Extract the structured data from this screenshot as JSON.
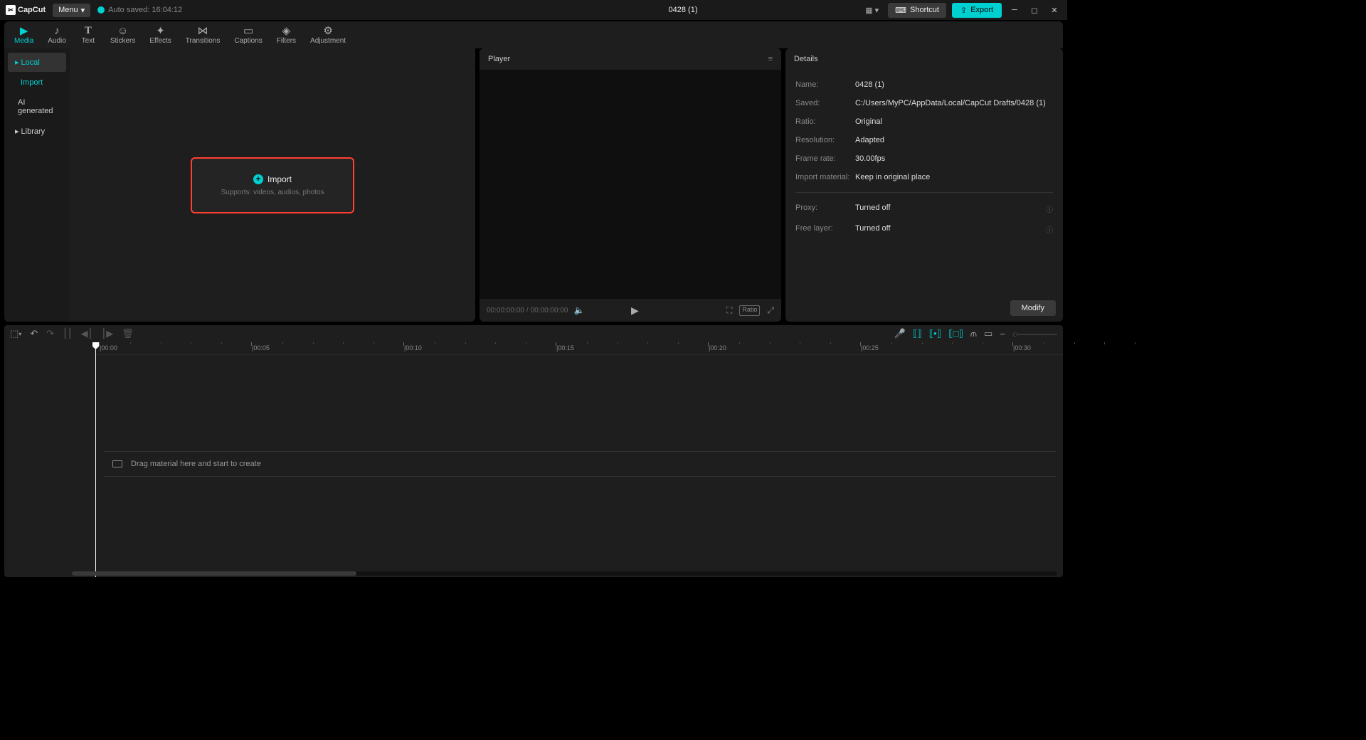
{
  "app": {
    "name": "CapCut",
    "menu_label": "Menu",
    "autosave": "Auto saved: 16:04:12",
    "project_title": "0428 (1)"
  },
  "titlebar": {
    "shortcut": "Shortcut",
    "export": "Export"
  },
  "top_tabs": [
    {
      "icon": "▶",
      "label": "Media",
      "active": true
    },
    {
      "icon": "♪",
      "label": "Audio"
    },
    {
      "icon": "T",
      "label": "Text"
    },
    {
      "icon": "☺",
      "label": "Stickers"
    },
    {
      "icon": "✦",
      "label": "Effects"
    },
    {
      "icon": "⋈",
      "label": "Transitions"
    },
    {
      "icon": "▭",
      "label": "Captions"
    },
    {
      "icon": "◈",
      "label": "Filters"
    },
    {
      "icon": "⚙",
      "label": "Adjustment"
    }
  ],
  "media_sidebar": {
    "local": "Local",
    "import": "Import",
    "ai": "AI generated",
    "library": "Library"
  },
  "import_box": {
    "title": "Import",
    "sub": "Supports: videos, audios, photos"
  },
  "player": {
    "title": "Player",
    "time_current": "00:00:00:00",
    "time_total": "00:00:00:00",
    "ratio_label": "Ratio"
  },
  "details": {
    "title": "Details",
    "rows": [
      {
        "label": "Name:",
        "value": "0428 (1)"
      },
      {
        "label": "Saved:",
        "value": "C:/Users/MyPC/AppData/Local/CapCut Drafts/0428 (1)"
      },
      {
        "label": "Ratio:",
        "value": "Original"
      },
      {
        "label": "Resolution:",
        "value": "Adapted"
      },
      {
        "label": "Frame rate:",
        "value": "30.00fps"
      },
      {
        "label": "Import material:",
        "value": "Keep in original place"
      }
    ],
    "rows2": [
      {
        "label": "Proxy:",
        "value": "Turned off"
      },
      {
        "label": "Free layer:",
        "value": "Turned off"
      }
    ],
    "modify": "Modify"
  },
  "ruler": [
    "00:00",
    "00:05",
    "00:10",
    "00:15",
    "00:20",
    "00:25",
    "00:30"
  ],
  "timeline_hint": "Drag material here and start to create"
}
